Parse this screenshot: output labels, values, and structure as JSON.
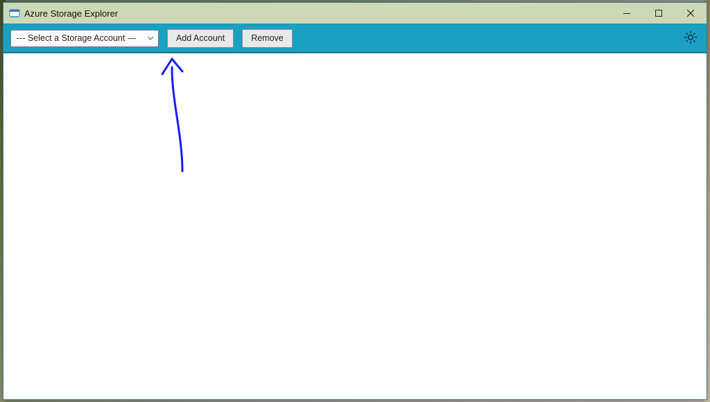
{
  "window": {
    "title": "Azure Storage Explorer"
  },
  "toolbar": {
    "account_selector": {
      "selected_label": "--- Select a Storage Account ---"
    },
    "add_account_label": "Add Account",
    "remove_label": "Remove"
  },
  "colors": {
    "titlebar_bg": "#cdd9b6",
    "toolbar_bg": "#1aa0c2",
    "annotation_stroke": "#1a1aff"
  }
}
